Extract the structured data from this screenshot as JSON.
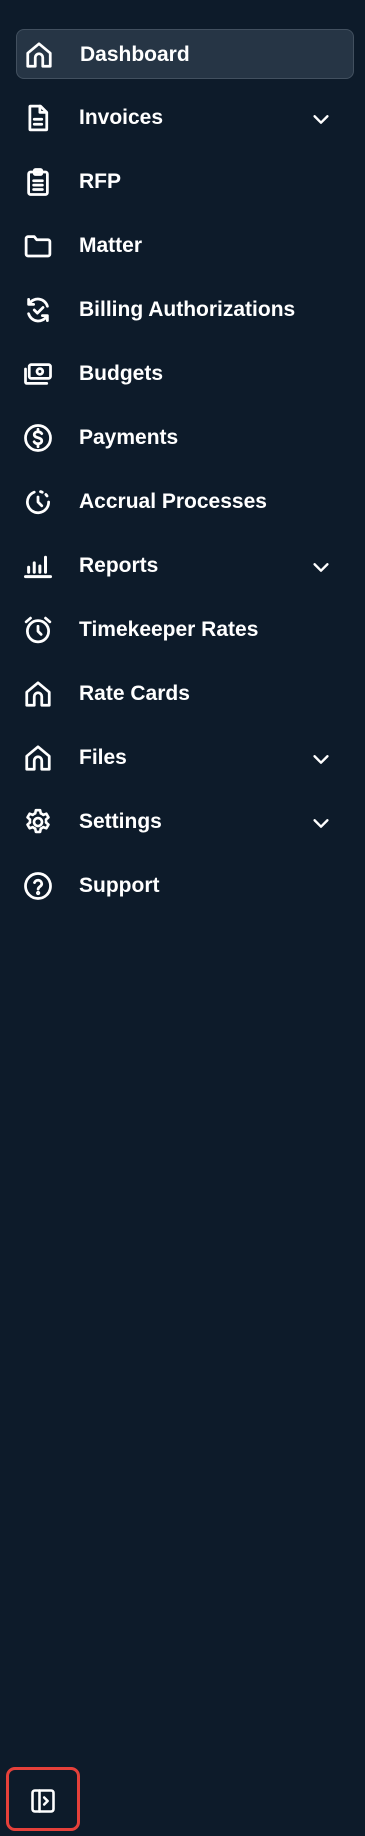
{
  "sidebar": {
    "items": [
      {
        "label": "Dashboard",
        "icon": "home-icon",
        "active": true,
        "expandable": false
      },
      {
        "label": "Invoices",
        "icon": "document-icon",
        "active": false,
        "expandable": true
      },
      {
        "label": "RFP",
        "icon": "clipboard-icon",
        "active": false,
        "expandable": false
      },
      {
        "label": "Matter",
        "icon": "folder-icon",
        "active": false,
        "expandable": false
      },
      {
        "label": "Billing Authorizations",
        "icon": "refresh-check-icon",
        "active": false,
        "expandable": false
      },
      {
        "label": "Budgets",
        "icon": "cash-icon",
        "active": false,
        "expandable": false
      },
      {
        "label": "Payments",
        "icon": "dollar-circle-icon",
        "active": false,
        "expandable": false
      },
      {
        "label": "Accrual Processes",
        "icon": "clock-progress-icon",
        "active": false,
        "expandable": false
      },
      {
        "label": "Reports",
        "icon": "bar-chart-icon",
        "active": false,
        "expandable": true
      },
      {
        "label": "Timekeeper Rates",
        "icon": "alarm-clock-icon",
        "active": false,
        "expandable": false
      },
      {
        "label": "Rate Cards",
        "icon": "home-icon",
        "active": false,
        "expandable": false
      },
      {
        "label": "Files",
        "icon": "home-icon",
        "active": false,
        "expandable": true
      },
      {
        "label": "Settings",
        "icon": "gear-icon",
        "active": false,
        "expandable": true
      },
      {
        "label": "Support",
        "icon": "question-circle-icon",
        "active": false,
        "expandable": false
      }
    ],
    "collapse_toggle": {
      "icon": "sidebar-expand-icon",
      "highlight_color": "#e5403a"
    }
  },
  "colors": {
    "background": "#0d1b2a",
    "active_item_bg": "#263545",
    "text": "#ffffff"
  }
}
